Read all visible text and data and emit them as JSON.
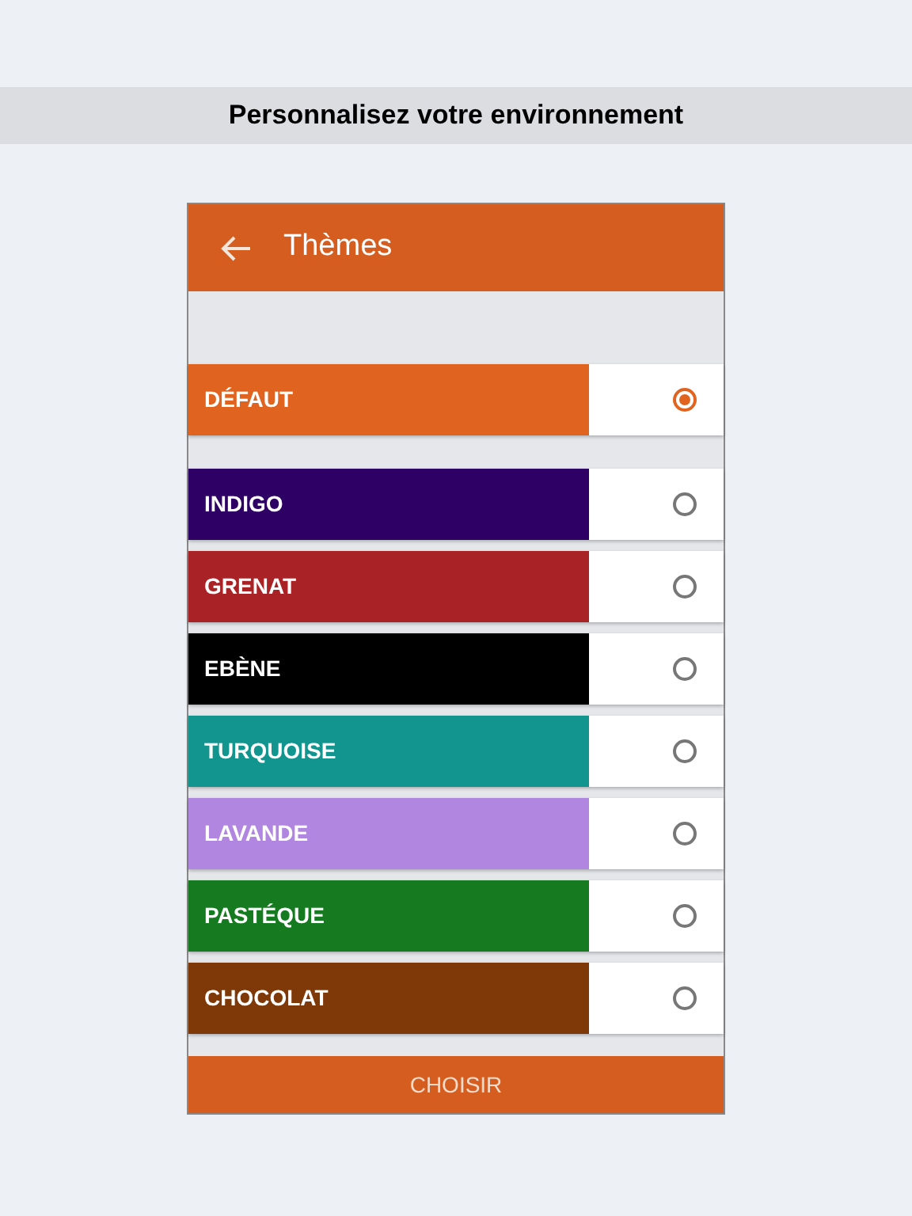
{
  "banner": {
    "title": "Personnalisez votre environnement"
  },
  "app_bar": {
    "title": "Thèmes"
  },
  "themes": [
    {
      "label": "DÉFAUT",
      "color": "#e06420",
      "selected": true
    },
    {
      "label": "INDIGO",
      "color": "#2e0066",
      "selected": false
    },
    {
      "label": "GRENAT",
      "color": "#a82226",
      "selected": false
    },
    {
      "label": "EBÈNE",
      "color": "#000000",
      "selected": false
    },
    {
      "label": "TURQUOISE",
      "color": "#13958f",
      "selected": false
    },
    {
      "label": "LAVANDE",
      "color": "#b086e0",
      "selected": false
    },
    {
      "label": "PASTÉQUE",
      "color": "#157a20",
      "selected": false
    },
    {
      "label": "CHOCOLAT",
      "color": "#7f3807",
      "selected": false
    }
  ],
  "choose_button": {
    "label": "CHOISIR"
  }
}
